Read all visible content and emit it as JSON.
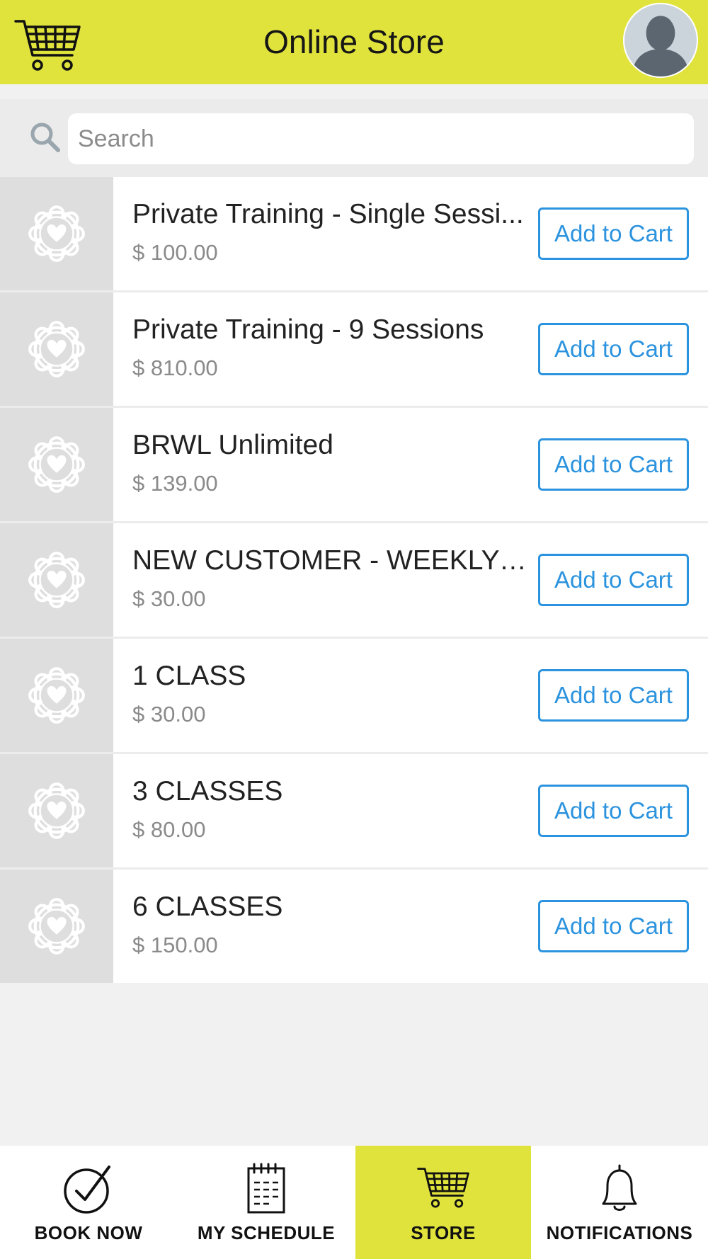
{
  "header": {
    "title": "Online Store"
  },
  "search": {
    "placeholder": "Search"
  },
  "products": [
    {
      "name": "Private Training - Single Sessi...",
      "price": "$ 100.00",
      "button": "Add to Cart"
    },
    {
      "name": "Private Training - 9 Sessions",
      "price": "$ 810.00",
      "button": "Add to Cart"
    },
    {
      "name": "BRWL Unlimited",
      "price": "$ 139.00",
      "button": "Add to Cart"
    },
    {
      "name": "NEW CUSTOMER - WEEKLY U...",
      "price": "$ 30.00",
      "button": "Add to Cart"
    },
    {
      "name": "1 CLASS",
      "price": "$ 30.00",
      "button": "Add to Cart"
    },
    {
      "name": "3 CLASSES",
      "price": "$ 80.00",
      "button": "Add to Cart"
    },
    {
      "name": "6 CLASSES",
      "price": "$ 150.00",
      "button": "Add to Cart"
    }
  ],
  "nav": {
    "items": [
      {
        "label": "BOOK NOW",
        "icon": "checkmark-circle-icon"
      },
      {
        "label": "MY SCHEDULE",
        "icon": "notepad-icon"
      },
      {
        "label": "STORE",
        "icon": "cart-icon",
        "active": true
      },
      {
        "label": "NOTIFICATIONS",
        "icon": "bell-icon"
      }
    ]
  },
  "colors": {
    "accent": "#e1e33d",
    "button": "#2c93de",
    "background": "#f1f1f1"
  }
}
